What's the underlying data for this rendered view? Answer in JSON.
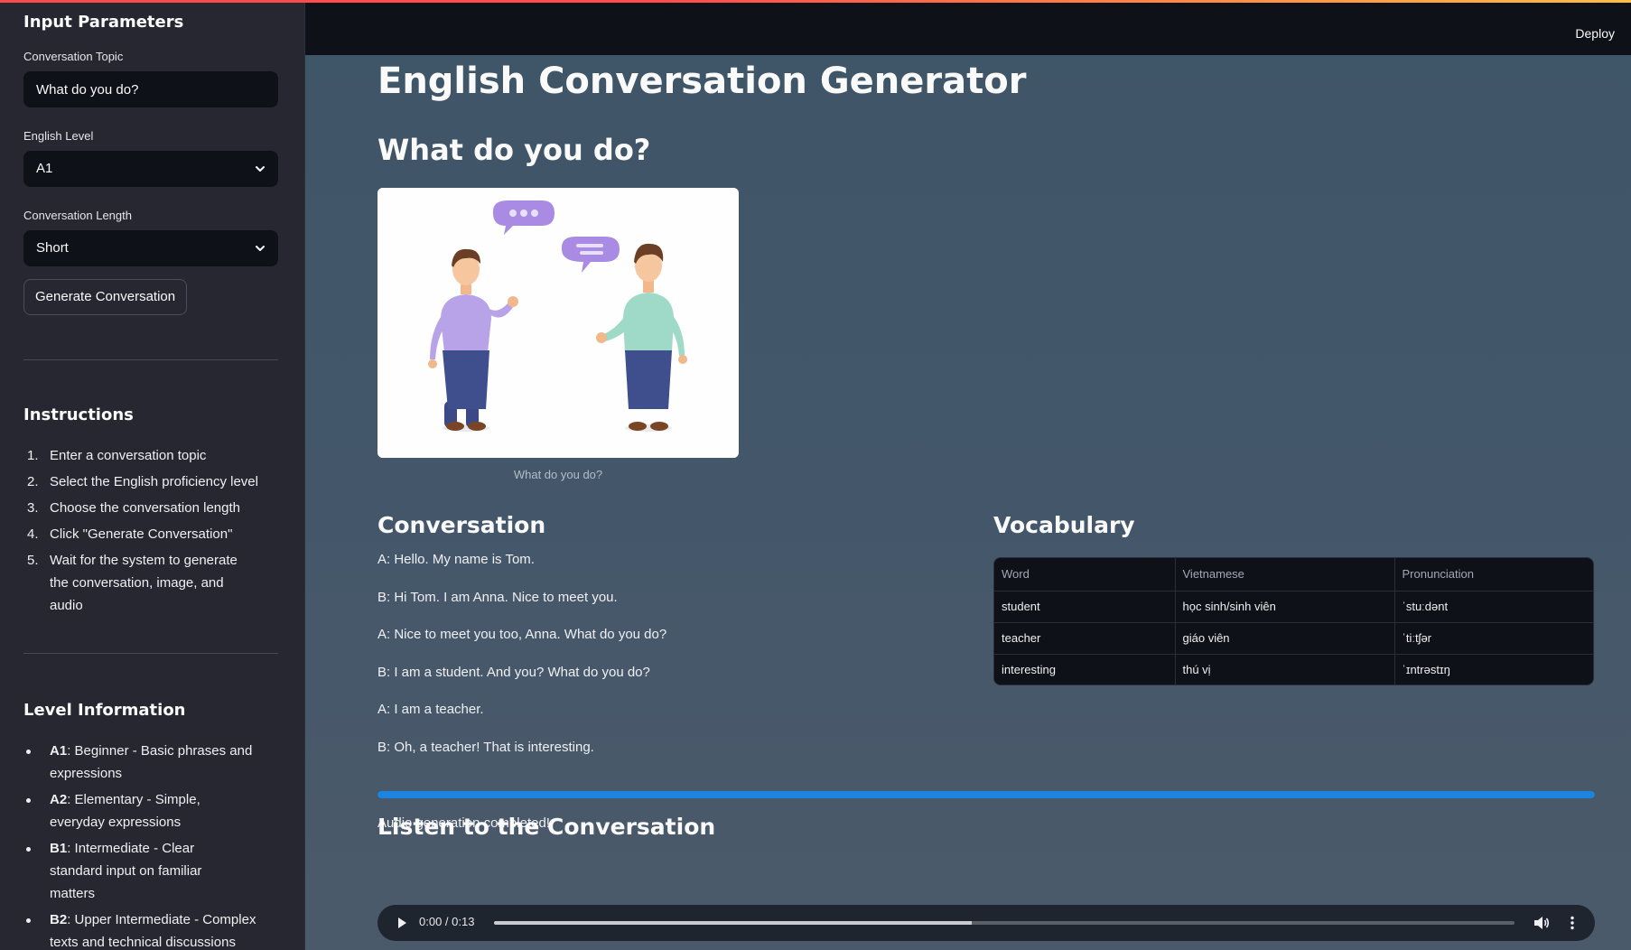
{
  "header": {
    "deploy_label": "Deploy"
  },
  "sidebar": {
    "title": "Input Parameters",
    "topic_label": "Conversation Topic",
    "topic_value": "What do you do?",
    "level_label": "English Level",
    "level_value": "A1",
    "length_label": "Conversation Length",
    "length_value": "Short",
    "generate_label": "Generate Conversation",
    "instructions_title": "Instructions",
    "instructions": [
      "Enter a conversation topic",
      "Select the English proficiency level",
      "Choose the conversation length",
      "Click \"Generate Conversation\"",
      "Wait for the system to generate the conversation, image, and audio"
    ],
    "level_info_title": "Level Information",
    "levels": [
      {
        "code": "A1",
        "desc": ": Beginner - Basic phrases and expressions"
      },
      {
        "code": "A2",
        "desc": ": Elementary - Simple, everyday expressions"
      },
      {
        "code": "B1",
        "desc": ": Intermediate - Clear standard input on familiar matters"
      },
      {
        "code": "B2",
        "desc": ": Upper Intermediate - Complex texts and technical discussions"
      }
    ]
  },
  "main": {
    "title": "English Conversation Generator",
    "topic_heading": "What do you do?",
    "image_caption": "What do you do?",
    "conversation_heading": "Conversation",
    "conversation": [
      "A: Hello. My name is Tom.",
      "B: Hi Tom. I am Anna. Nice to meet you.",
      "A: Nice to meet you too, Anna. What do you do?",
      "B: I am a student. And you? What do you do?",
      "A: I am a teacher.",
      "B: Oh, a teacher! That is interesting."
    ],
    "vocabulary_heading": "Vocabulary",
    "vocab_columns": [
      "Word",
      "Vietnamese",
      "Pronunciation"
    ],
    "vocab_rows": [
      [
        "student",
        "học sinh/sinh viên",
        "ˈstuːdənt"
      ],
      [
        "teacher",
        "giáo viên",
        "ˈtiːtʃər"
      ],
      [
        "interesting",
        "thú vị",
        "ˈɪntrəstɪŋ"
      ]
    ],
    "progress_percent": 100,
    "status_text": "Audio generation completed!",
    "listen_heading": "Listen to the Conversation",
    "audio": {
      "time": "0:00 / 0:13",
      "played_fraction": 0.468
    }
  },
  "colors": {
    "accent": "#1c83e1",
    "sidebar_bg": "#262730",
    "header_bg": "#0e1117"
  }
}
